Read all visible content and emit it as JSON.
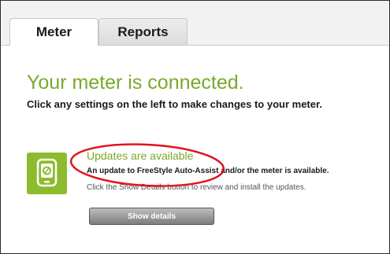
{
  "tabs": [
    {
      "label": "Meter"
    },
    {
      "label": "Reports"
    }
  ],
  "main": {
    "headline": "Your meter is connected.",
    "subline": "Click any settings on the left to make changes to your meter."
  },
  "updates": {
    "title": "Updates are available",
    "line1": "An update to FreeStyle Auto-Assist and/or the meter is available.",
    "line2": "Click the Show Details button to review and install the updates.",
    "button_label": "Show details"
  },
  "colors": {
    "accent_green": "#7aa92a",
    "tile_green": "#8dbb2e",
    "annotation_red": "#e0141e"
  },
  "icons": {
    "device": "meter-device-icon"
  }
}
